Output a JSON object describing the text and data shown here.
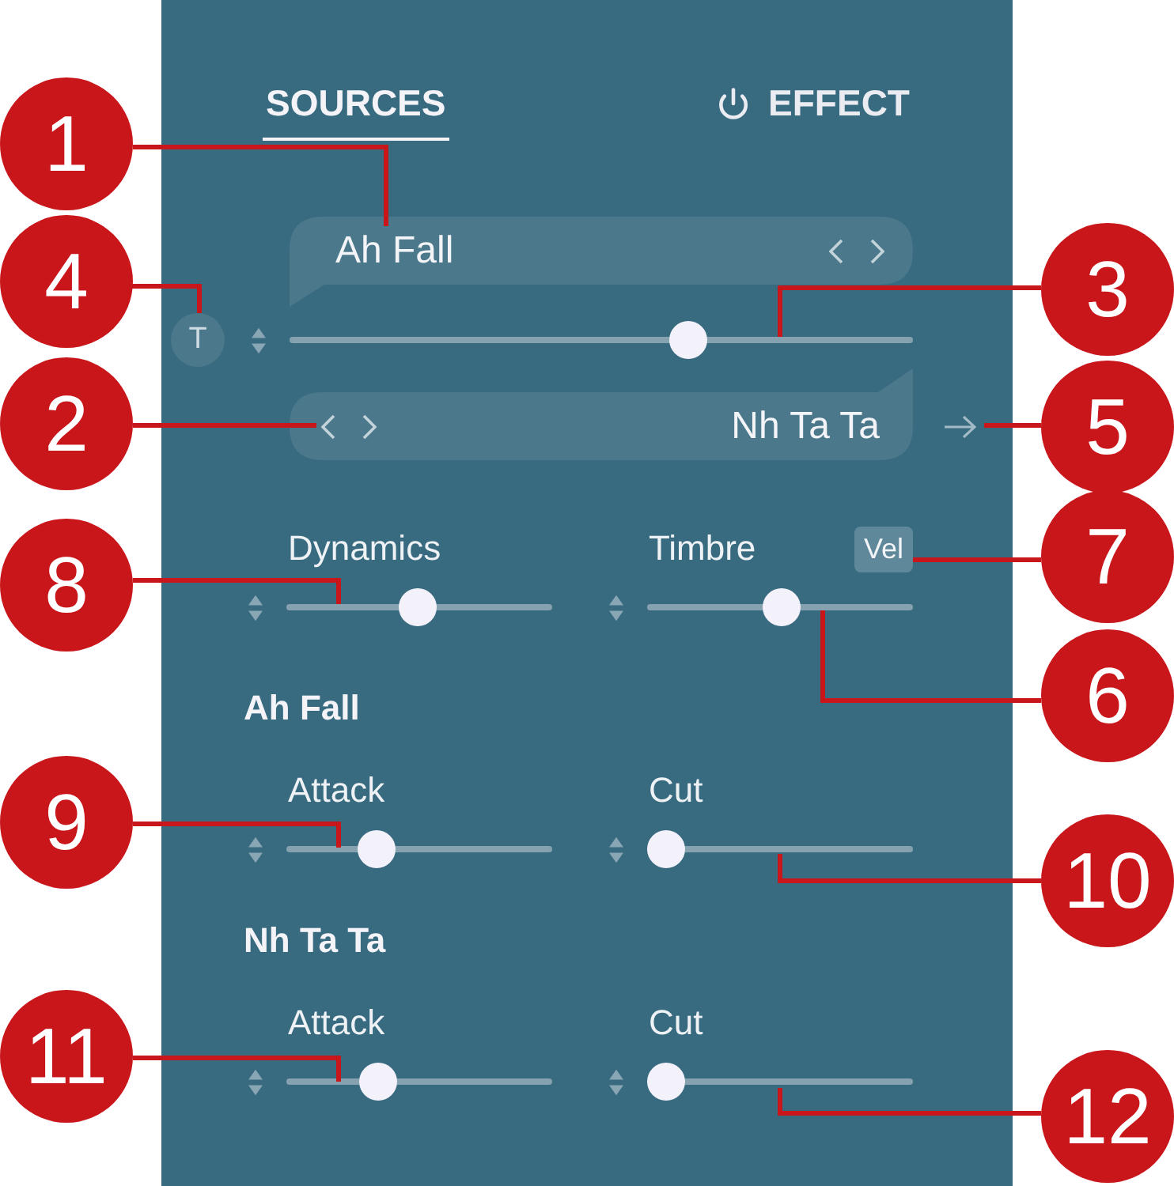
{
  "tabs": [
    {
      "label": "SOURCES",
      "selected": true,
      "kind": "plain"
    },
    {
      "label": "EFFECT",
      "selected": false,
      "kind": "power"
    }
  ],
  "source_a": {
    "name": "Ah Fall"
  },
  "morph": {
    "toggle": "T",
    "level": 0.65
  },
  "source_b": {
    "name": "Nh Ta Ta"
  },
  "macros": [
    {
      "label": "Dynamics",
      "level": 0.49
    },
    {
      "label": "Timbre",
      "level": 0.51,
      "badge": "Vel"
    }
  ],
  "sections": [
    {
      "title": "Ah Fall",
      "controls": [
        {
          "label": "Attack",
          "level": 0.31
        },
        {
          "label": "Cut",
          "level": 0
        }
      ]
    },
    {
      "title": "Nh Ta Ta",
      "controls": [
        {
          "label": "Attack",
          "level": 0.32
        },
        {
          "label": "Cut",
          "level": 0
        }
      ]
    }
  ],
  "callouts": [
    "1",
    "4",
    "3",
    "2",
    "5",
    "8",
    "7",
    "6",
    "9",
    "10",
    "11",
    "12"
  ]
}
